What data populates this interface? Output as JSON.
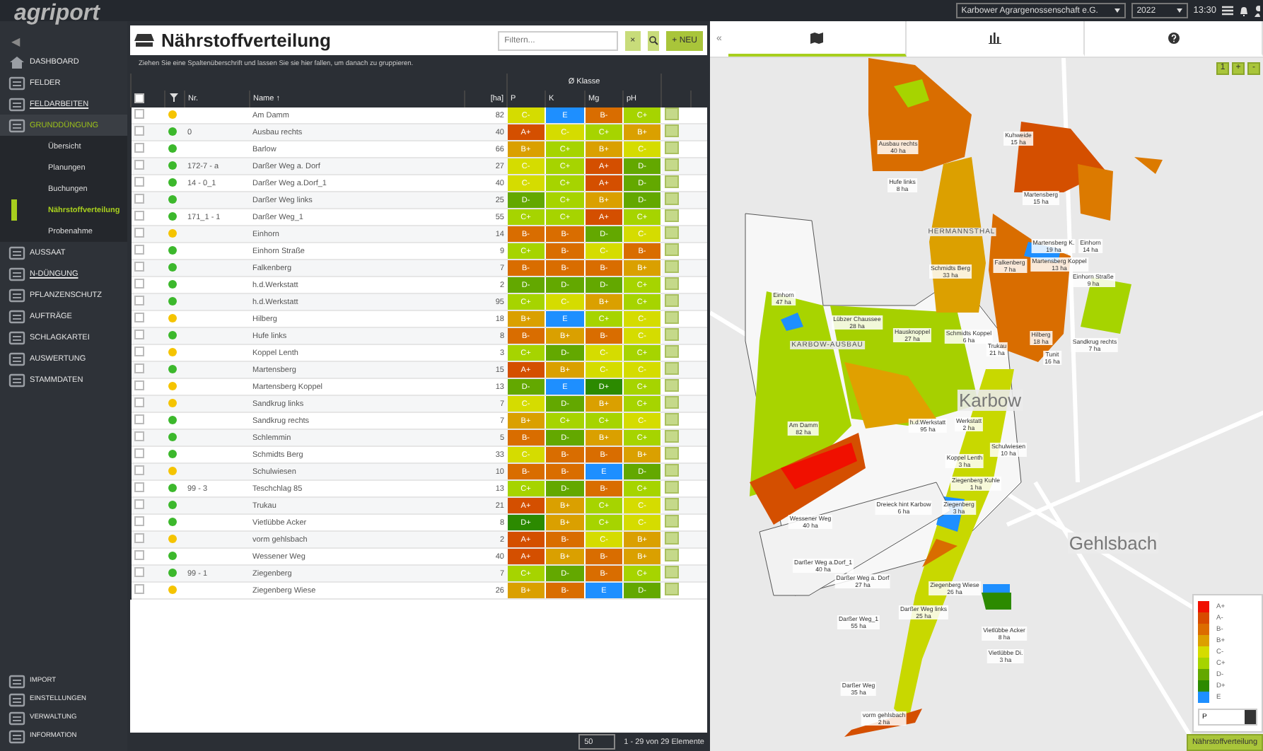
{
  "topbar": {
    "company": "Karbower Agrargenossenschaft e.G.",
    "year": "2022",
    "time": "13:30"
  },
  "brand": {
    "logo": "agriport"
  },
  "sidebar": {
    "collapse": "◀",
    "items": [
      {
        "label": "DASHBOARD",
        "underlined": false,
        "expanded": false
      },
      {
        "label": "FELDER",
        "underlined": false,
        "expanded": false
      },
      {
        "label": "FELDARBEITEN",
        "underlined": true,
        "expanded": false
      },
      {
        "label": "GRUNDDÜNGUNG",
        "underlined": false,
        "expanded": true,
        "children": [
          {
            "label": "Übersicht",
            "selected": false
          },
          {
            "label": "Planungen",
            "selected": false
          },
          {
            "label": "Buchungen",
            "selected": false
          },
          {
            "label": "Nährstoffverteilung",
            "selected": true
          },
          {
            "label": "Probenahme",
            "selected": false
          }
        ]
      },
      {
        "label": "AUSSAAT",
        "underlined": false,
        "expanded": false
      },
      {
        "label": "N-DÜNGUNG",
        "underlined": true,
        "expanded": false
      },
      {
        "label": "PFLANZENSCHUTZ",
        "underlined": false,
        "expanded": false
      },
      {
        "label": "AUFTRÄGE",
        "underlined": false,
        "expanded": false
      },
      {
        "label": "SCHLAGKARTEI",
        "underlined": false,
        "expanded": false
      },
      {
        "label": "AUSWERTUNG",
        "underlined": false,
        "expanded": false
      },
      {
        "label": "STAMMDATEN",
        "underlined": false,
        "expanded": false
      }
    ],
    "bottom_items": [
      "IMPORT",
      "EINSTELLUNGEN",
      "VERWALTUNG",
      "INFORMATION"
    ]
  },
  "panel": {
    "title": "Nährstoffverteilung",
    "filter_placeholder": "Filtern...",
    "clear": "×",
    "new_button": "+ NEU",
    "group_hint": "Ziehen Sie eine Spaltenüberschrift und lassen Sie sie hier fallen, um danach zu gruppieren."
  },
  "table": {
    "all_checked": false,
    "group_header": "Ø Klasse",
    "columns": [
      "Nr.",
      "Name ↑",
      "[ha]"
    ],
    "grade_columns": [
      "P",
      "K",
      "Mg",
      "pH"
    ],
    "rows": [
      {
        "checked": false,
        "nr": "",
        "name": "Am Damm",
        "ha": "82",
        "color": "#f5c400",
        "cells": [
          {
            "grade": "C-",
            "color": "#d5dc00"
          },
          {
            "grade": "E",
            "color": "#1e8fff"
          },
          {
            "grade": "B-",
            "color": "#d96d00"
          },
          {
            "grade": "C+",
            "color": "#a6d400"
          }
        ]
      },
      {
        "checked": false,
        "nr": "0",
        "name": "Ausbau rechts",
        "ha": "40",
        "color": "#3cb82c",
        "cells": [
          {
            "grade": "A+",
            "color": "#d44f00"
          },
          {
            "grade": "C-",
            "color": "#d5dc00"
          },
          {
            "grade": "C+",
            "color": "#a6d400"
          },
          {
            "grade": "B+",
            "color": "#daa000"
          }
        ]
      },
      {
        "checked": false,
        "nr": "",
        "name": "Barlow",
        "ha": "66",
        "color": "#3cb82c",
        "cells": [
          {
            "grade": "B+",
            "color": "#daa000"
          },
          {
            "grade": "C+",
            "color": "#a6d400"
          },
          {
            "grade": "B+",
            "color": "#daa000"
          },
          {
            "grade": "C-",
            "color": "#d5dc00"
          }
        ]
      },
      {
        "checked": false,
        "nr": "172-7 - a",
        "name": "Darßer Weg a. Dorf",
        "ha": "27",
        "color": "#3cb82c",
        "cells": [
          {
            "grade": "C-",
            "color": "#d5dc00"
          },
          {
            "grade": "C+",
            "color": "#a6d400"
          },
          {
            "grade": "A+",
            "color": "#d44f00"
          },
          {
            "grade": "D-",
            "color": "#63a800"
          }
        ]
      },
      {
        "checked": false,
        "nr": "14 - 0_1",
        "name": "Darßer Weg a.Dorf_1",
        "ha": "40",
        "color": "#3cb82c",
        "cells": [
          {
            "grade": "C-",
            "color": "#d5dc00"
          },
          {
            "grade": "C+",
            "color": "#a6d400"
          },
          {
            "grade": "A+",
            "color": "#d44f00"
          },
          {
            "grade": "D-",
            "color": "#63a800"
          }
        ]
      },
      {
        "checked": false,
        "nr": "",
        "name": "Darßer Weg links",
        "ha": "25",
        "color": "#3cb82c",
        "cells": [
          {
            "grade": "D-",
            "color": "#63a800"
          },
          {
            "grade": "C+",
            "color": "#a6d400"
          },
          {
            "grade": "B+",
            "color": "#daa000"
          },
          {
            "grade": "D-",
            "color": "#63a800"
          }
        ]
      },
      {
        "checked": false,
        "nr": "171_1 - 1",
        "name": "Darßer Weg_1",
        "ha": "55",
        "color": "#3cb82c",
        "cells": [
          {
            "grade": "C+",
            "color": "#a6d400"
          },
          {
            "grade": "C+",
            "color": "#a6d400"
          },
          {
            "grade": "A+",
            "color": "#d44f00"
          },
          {
            "grade": "C+",
            "color": "#a6d400"
          }
        ]
      },
      {
        "checked": false,
        "nr": "",
        "name": "Einhorn",
        "ha": "14",
        "color": "#f5c400",
        "cells": [
          {
            "grade": "B-",
            "color": "#d96d00"
          },
          {
            "grade": "B-",
            "color": "#d96d00"
          },
          {
            "grade": "D-",
            "color": "#63a800"
          },
          {
            "grade": "C-",
            "color": "#d5dc00"
          }
        ]
      },
      {
        "checked": false,
        "nr": "",
        "name": "Einhorn Straße",
        "ha": "9",
        "color": "#3cb82c",
        "cells": [
          {
            "grade": "C+",
            "color": "#a6d400"
          },
          {
            "grade": "B-",
            "color": "#d96d00"
          },
          {
            "grade": "C-",
            "color": "#d5dc00"
          },
          {
            "grade": "B-",
            "color": "#d96d00"
          }
        ]
      },
      {
        "checked": false,
        "nr": "",
        "name": "Falkenberg",
        "ha": "7",
        "color": "#3cb82c",
        "cells": [
          {
            "grade": "B-",
            "color": "#d96d00"
          },
          {
            "grade": "B-",
            "color": "#d96d00"
          },
          {
            "grade": "B-",
            "color": "#d96d00"
          },
          {
            "grade": "B+",
            "color": "#daa000"
          }
        ]
      },
      {
        "checked": false,
        "nr": "",
        "name": "h.d.Werkstatt",
        "ha": "2",
        "color": "#3cb82c",
        "cells": [
          {
            "grade": "D-",
            "color": "#63a800"
          },
          {
            "grade": "D-",
            "color": "#63a800"
          },
          {
            "grade": "D-",
            "color": "#63a800"
          },
          {
            "grade": "C+",
            "color": "#a6d400"
          }
        ]
      },
      {
        "checked": false,
        "nr": "",
        "name": "h.d.Werkstatt",
        "ha": "95",
        "color": "#3cb82c",
        "cells": [
          {
            "grade": "C+",
            "color": "#a6d400"
          },
          {
            "grade": "C-",
            "color": "#d5dc00"
          },
          {
            "grade": "B+",
            "color": "#daa000"
          },
          {
            "grade": "C+",
            "color": "#a6d400"
          }
        ]
      },
      {
        "checked": false,
        "nr": "",
        "name": "Hilberg",
        "ha": "18",
        "color": "#f5c400",
        "cells": [
          {
            "grade": "B+",
            "color": "#daa000"
          },
          {
            "grade": "E",
            "color": "#1e8fff"
          },
          {
            "grade": "C+",
            "color": "#a6d400"
          },
          {
            "grade": "C-",
            "color": "#d5dc00"
          }
        ]
      },
      {
        "checked": false,
        "nr": "",
        "name": "Hufe links",
        "ha": "8",
        "color": "#3cb82c",
        "cells": [
          {
            "grade": "B-",
            "color": "#d96d00"
          },
          {
            "grade": "B+",
            "color": "#daa000"
          },
          {
            "grade": "B-",
            "color": "#d96d00"
          },
          {
            "grade": "C-",
            "color": "#d5dc00"
          }
        ]
      },
      {
        "checked": false,
        "nr": "",
        "name": "Koppel Lenth",
        "ha": "3",
        "color": "#f5c400",
        "cells": [
          {
            "grade": "C+",
            "color": "#a6d400"
          },
          {
            "grade": "D-",
            "color": "#63a800"
          },
          {
            "grade": "C-",
            "color": "#d5dc00"
          },
          {
            "grade": "C+",
            "color": "#a6d400"
          }
        ]
      },
      {
        "checked": false,
        "nr": "",
        "name": "Martensberg",
        "ha": "15",
        "color": "#3cb82c",
        "cells": [
          {
            "grade": "A+",
            "color": "#d44f00"
          },
          {
            "grade": "B+",
            "color": "#daa000"
          },
          {
            "grade": "C-",
            "color": "#d5dc00"
          },
          {
            "grade": "C-",
            "color": "#d5dc00"
          }
        ]
      },
      {
        "checked": false,
        "nr": "",
        "name": "Martensberg Koppel",
        "ha": "13",
        "color": "#f5c400",
        "cells": [
          {
            "grade": "D-",
            "color": "#63a800"
          },
          {
            "grade": "E",
            "color": "#1e8fff"
          },
          {
            "grade": "D+",
            "color": "#2c8a00"
          },
          {
            "grade": "C+",
            "color": "#a6d400"
          }
        ]
      },
      {
        "checked": false,
        "nr": "",
        "name": "Sandkrug links",
        "ha": "7",
        "color": "#f5c400",
        "cells": [
          {
            "grade": "C-",
            "color": "#d5dc00"
          },
          {
            "grade": "D-",
            "color": "#63a800"
          },
          {
            "grade": "B+",
            "color": "#daa000"
          },
          {
            "grade": "C+",
            "color": "#a6d400"
          }
        ]
      },
      {
        "checked": false,
        "nr": "",
        "name": "Sandkrug rechts",
        "ha": "7",
        "color": "#3cb82c",
        "cells": [
          {
            "grade": "B+",
            "color": "#daa000"
          },
          {
            "grade": "C+",
            "color": "#a6d400"
          },
          {
            "grade": "C+",
            "color": "#a6d400"
          },
          {
            "grade": "C-",
            "color": "#d5dc00"
          }
        ]
      },
      {
        "checked": false,
        "nr": "",
        "name": "Schlemmin",
        "ha": "5",
        "color": "#3cb82c",
        "cells": [
          {
            "grade": "B-",
            "color": "#d96d00"
          },
          {
            "grade": "D-",
            "color": "#63a800"
          },
          {
            "grade": "B+",
            "color": "#daa000"
          },
          {
            "grade": "C+",
            "color": "#a6d400"
          }
        ]
      },
      {
        "checked": false,
        "nr": "",
        "name": "Schmidts Berg",
        "ha": "33",
        "color": "#3cb82c",
        "cells": [
          {
            "grade": "C-",
            "color": "#d5dc00"
          },
          {
            "grade": "B-",
            "color": "#d96d00"
          },
          {
            "grade": "B-",
            "color": "#d96d00"
          },
          {
            "grade": "B+",
            "color": "#daa000"
          }
        ]
      },
      {
        "checked": false,
        "nr": "",
        "name": "Schulwiesen",
        "ha": "10",
        "color": "#f5c400",
        "cells": [
          {
            "grade": "B-",
            "color": "#d96d00"
          },
          {
            "grade": "B-",
            "color": "#d96d00"
          },
          {
            "grade": "E",
            "color": "#1e8fff"
          },
          {
            "grade": "D-",
            "color": "#63a800"
          }
        ]
      },
      {
        "checked": false,
        "nr": "99 - 3",
        "name": "Teschchlag 85",
        "ha": "13",
        "color": "#3cb82c",
        "cells": [
          {
            "grade": "C+",
            "color": "#a6d400"
          },
          {
            "grade": "D-",
            "color": "#63a800"
          },
          {
            "grade": "B-",
            "color": "#d96d00"
          },
          {
            "grade": "C+",
            "color": "#a6d400"
          }
        ]
      },
      {
        "checked": false,
        "nr": "",
        "name": "Trukau",
        "ha": "21",
        "color": "#3cb82c",
        "cells": [
          {
            "grade": "A+",
            "color": "#d44f00"
          },
          {
            "grade": "B+",
            "color": "#daa000"
          },
          {
            "grade": "C+",
            "color": "#a6d400"
          },
          {
            "grade": "C-",
            "color": "#d5dc00"
          }
        ]
      },
      {
        "checked": false,
        "nr": "",
        "name": "Vietlübbe Acker",
        "ha": "8",
        "color": "#3cb82c",
        "cells": [
          {
            "grade": "D+",
            "color": "#2c8a00"
          },
          {
            "grade": "B+",
            "color": "#daa000"
          },
          {
            "grade": "C+",
            "color": "#a6d400"
          },
          {
            "grade": "C-",
            "color": "#d5dc00"
          }
        ]
      },
      {
        "checked": false,
        "nr": "",
        "name": "vorm gehlsbach",
        "ha": "2",
        "color": "#f5c400",
        "cells": [
          {
            "grade": "A+",
            "color": "#d44f00"
          },
          {
            "grade": "B-",
            "color": "#d96d00"
          },
          {
            "grade": "C-",
            "color": "#d5dc00"
          },
          {
            "grade": "B+",
            "color": "#daa000"
          }
        ]
      },
      {
        "checked": false,
        "nr": "",
        "name": "Wessener Weg",
        "ha": "40",
        "color": "#3cb82c",
        "cells": [
          {
            "grade": "A+",
            "color": "#d44f00"
          },
          {
            "grade": "B+",
            "color": "#daa000"
          },
          {
            "grade": "B-",
            "color": "#d96d00"
          },
          {
            "grade": "B+",
            "color": "#daa000"
          }
        ]
      },
      {
        "checked": false,
        "nr": "99 - 1",
        "name": "Ziegenberg",
        "ha": "7",
        "color": "#3cb82c",
        "cells": [
          {
            "grade": "C+",
            "color": "#a6d400"
          },
          {
            "grade": "D-",
            "color": "#63a800"
          },
          {
            "grade": "B-",
            "color": "#d96d00"
          },
          {
            "grade": "C+",
            "color": "#a6d400"
          }
        ]
      },
      {
        "checked": false,
        "nr": "",
        "name": "Ziegenberg Wiese",
        "ha": "26",
        "color": "#f5c400",
        "cells": [
          {
            "grade": "B+",
            "color": "#daa000"
          },
          {
            "grade": "B-",
            "color": "#d96d00"
          },
          {
            "grade": "E",
            "color": "#1e8fff"
          },
          {
            "grade": "D-",
            "color": "#63a800"
          }
        ]
      }
    ]
  },
  "pager": {
    "page_size": "50",
    "summary": "1 - 29 von 29 Elemente"
  },
  "right_tabs": {
    "collapse": "«",
    "tabs": [
      {
        "selected": true
      },
      {
        "selected": false
      },
      {
        "selected": false
      }
    ]
  },
  "map": {
    "controls": [
      "1",
      "+",
      "-"
    ],
    "places": [
      "HERMANNSTHAL",
      "KARBOW-AUSBAU",
      "Karbow",
      "Gehlsbach"
    ],
    "labels": [
      {
        "name": "Ausbau rechts",
        "area": "40 ha"
      },
      {
        "name": "Hufe links",
        "area": "8 ha"
      },
      {
        "name": "Kuhweide",
        "area": "15 ha"
      },
      {
        "name": "Martensberg",
        "area": "15 ha"
      },
      {
        "name": "Martensberg K.",
        "area": "19 ha"
      },
      {
        "name": "Einhorn",
        "area": "14 ha"
      },
      {
        "name": "Schmidts Berg",
        "area": "33 ha"
      },
      {
        "name": "Falkenberg",
        "area": "7 ha"
      },
      {
        "name": "Martensberg Koppel",
        "area": "13 ha"
      },
      {
        "name": "Einhorn Straße",
        "area": "9 ha"
      },
      {
        "name": "Einhorn",
        "area": "47 ha"
      },
      {
        "name": "Lübzer Chaussee",
        "area": "28 ha"
      },
      {
        "name": "Hausknoppel",
        "area": "27 ha"
      },
      {
        "name": "Schmidts Koppel",
        "area": "6 ha"
      },
      {
        "name": "Trukau",
        "area": "21 ha"
      },
      {
        "name": "Hilberg",
        "area": "18 ha"
      },
      {
        "name": "Sandkrug rechts",
        "area": "7 ha"
      },
      {
        "name": "Tunit",
        "area": "16 ha"
      },
      {
        "name": "Am Damm",
        "area": "82 ha"
      },
      {
        "name": "h.d.Werkstatt",
        "area": "95 ha"
      },
      {
        "name": "Werkstatt",
        "area": "2 ha"
      },
      {
        "name": "Schulwiesen",
        "area": "10 ha"
      },
      {
        "name": "Koppel Lenth",
        "area": "3 ha"
      },
      {
        "name": "Ziegenberg Kuhle",
        "area": "1 ha"
      },
      {
        "name": "Dreieck hint Karbow",
        "area": "6 ha"
      },
      {
        "name": "Ziegenberg",
        "area": "3 ha"
      },
      {
        "name": "Wessener Weg",
        "area": "40 ha"
      },
      {
        "name": "Darßer Weg a.Dorf_1",
        "area": "40 ha"
      },
      {
        "name": "Darßer Weg a. Dorf",
        "area": "27 ha"
      },
      {
        "name": "Ziegenberg Wiese",
        "area": "26 ha"
      },
      {
        "name": "Darßer Weg links",
        "area": "25 ha"
      },
      {
        "name": "Darßer Weg_1",
        "area": "55 ha"
      },
      {
        "name": "Vietlübbe Acker",
        "area": "8 ha"
      },
      {
        "name": "Vietlübbe Di.",
        "area": "3 ha"
      },
      {
        "name": "Darßer Weg",
        "area": "35 ha"
      },
      {
        "name": "vorm gehlsbach",
        "area": "2 ha"
      }
    ],
    "legend": {
      "entries": [
        {
          "label": "A+",
          "color": "#f01000"
        },
        {
          "label": "A-",
          "color": "#d84a00"
        },
        {
          "label": "B-",
          "color": "#dc6c00"
        },
        {
          "label": "B+",
          "color": "#dca000"
        },
        {
          "label": "C-",
          "color": "#d5dc00"
        },
        {
          "label": "C+",
          "color": "#a6d400"
        },
        {
          "label": "D-",
          "color": "#63a800"
        },
        {
          "label": "D+",
          "color": "#2c8a00"
        },
        {
          "label": "E",
          "color": "#1e8fff"
        }
      ],
      "nutrient": "P"
    },
    "layer_button": "Nährstoffverteilung"
  }
}
